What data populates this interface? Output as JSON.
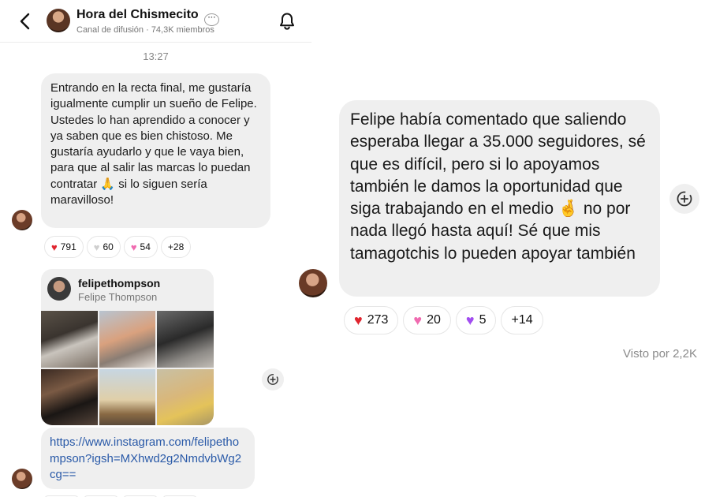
{
  "header": {
    "title": "Hora del Chismecito",
    "title_icon": "chat-bubble-icon",
    "channel_type": "Canal de difusión",
    "separator": "·",
    "members": "74,3K miembros"
  },
  "timestamp": "13:27",
  "message1": {
    "text": "Entrando en la recta final, me gustaría igualmente cumplir un sueño de Felipe. Ustedes lo han aprendido a conocer y ya saben que es bien chistoso. Me gustaría ayudarlo y que le vaya bien, para que al salir las marcas lo puedan contratar 🙏 si lo siguen sería maravilloso!",
    "reactions": [
      {
        "emoji": "❤️",
        "count": "791"
      },
      {
        "emoji": "🤍",
        "count": "60"
      },
      {
        "emoji": "💗",
        "count": "54"
      },
      {
        "emoji": "",
        "count": "+28"
      }
    ]
  },
  "profile_card": {
    "username": "felipethompson",
    "full_name": "Felipe Thompson"
  },
  "link_message": {
    "url": "https://www.instagram.com/felipethompson?igsh=MXhwd2g2NmdvbWg2cg=="
  },
  "message2": {
    "text": "Felipe había comentado que saliendo esperaba llegar a 35.000 seguidores, sé que es difícil, pero si lo apoyamos también le damos la oportunidad que siga trabajando en el medio 🤞 no por nada llegó hasta aquí! Sé que mis tamagotchis lo pueden apoyar también",
    "reactions": [
      {
        "emoji": "❤️",
        "count": "273"
      },
      {
        "emoji": "💗",
        "count": "20"
      },
      {
        "emoji": "💜",
        "count": "5"
      },
      {
        "emoji": "",
        "count": "+14"
      }
    ],
    "seen": "Visto por 2,2K"
  },
  "colors": {
    "bubble": "#efefef",
    "link": "#2a5aa8",
    "muted": "#777777"
  }
}
